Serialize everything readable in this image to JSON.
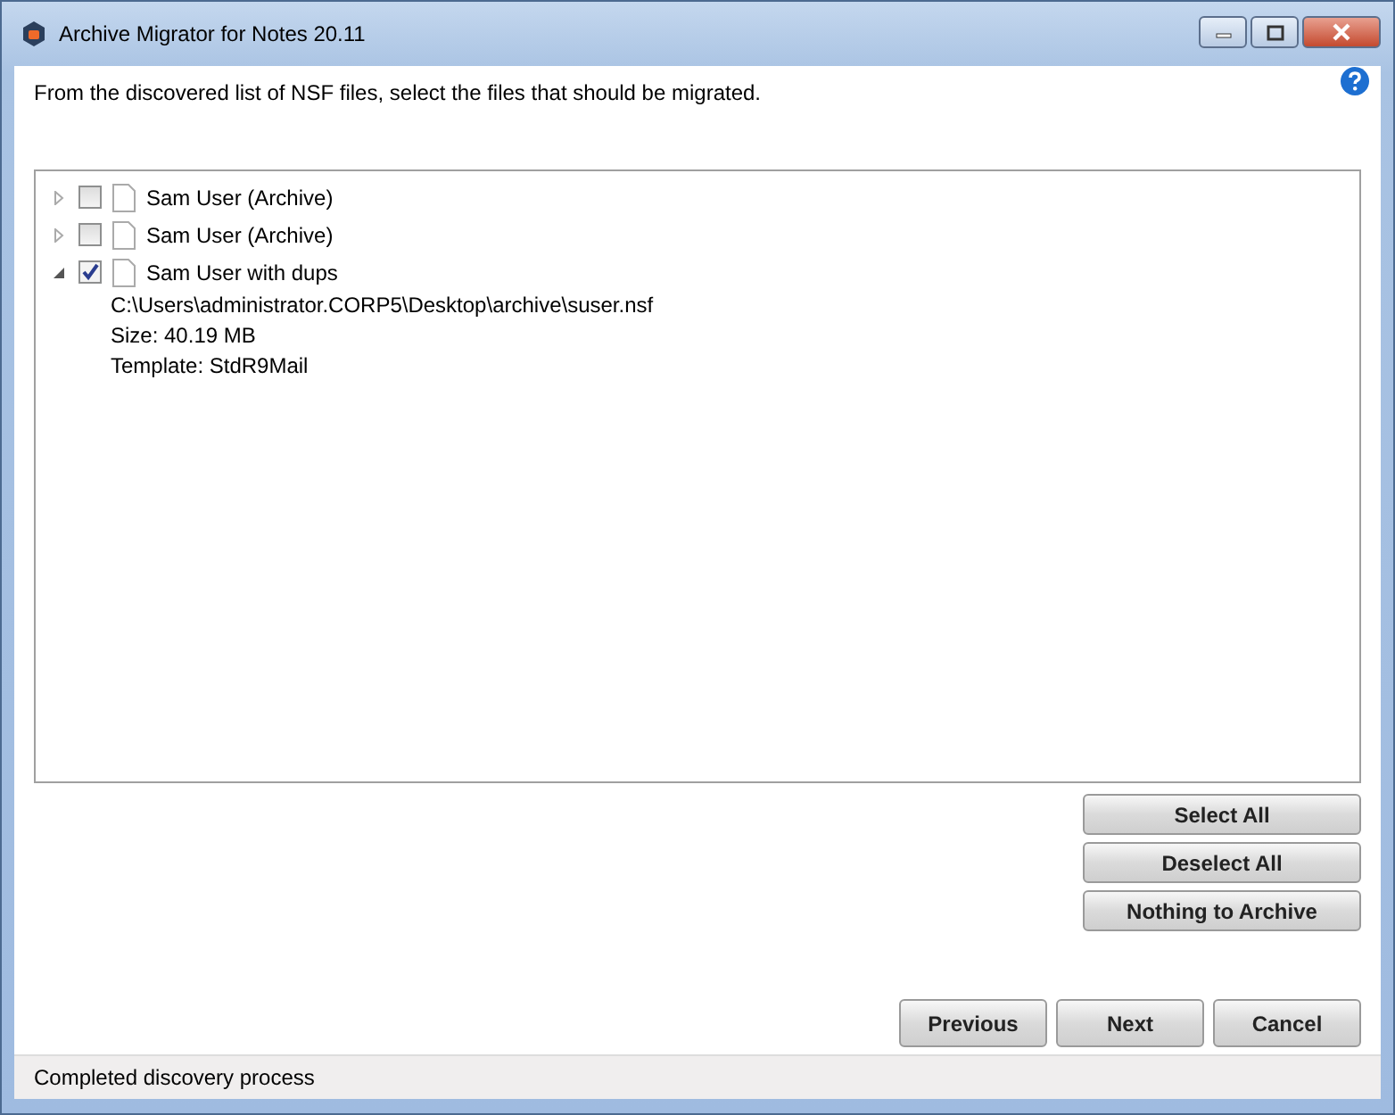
{
  "window": {
    "title": "Archive Migrator for Notes 20.11"
  },
  "instruction": "From the discovered list of NSF files, select the files that should be migrated.",
  "tree": [
    {
      "label": "Sam User (Archive)",
      "checked": false,
      "expanded": false
    },
    {
      "label": "Sam User (Archive)",
      "checked": false,
      "expanded": false
    },
    {
      "label": "Sam User with dups",
      "checked": true,
      "expanded": true,
      "details": [
        "C:\\Users\\administrator.CORP5\\Desktop\\archive\\suser.nsf",
        "Size: 40.19 MB",
        "Template: StdR9Mail"
      ]
    }
  ],
  "side_buttons": [
    "Select All",
    "Deselect All",
    "Nothing to Archive"
  ],
  "nav_buttons": [
    "Previous",
    "Next",
    "Cancel"
  ],
  "status_bar": "Completed discovery process"
}
